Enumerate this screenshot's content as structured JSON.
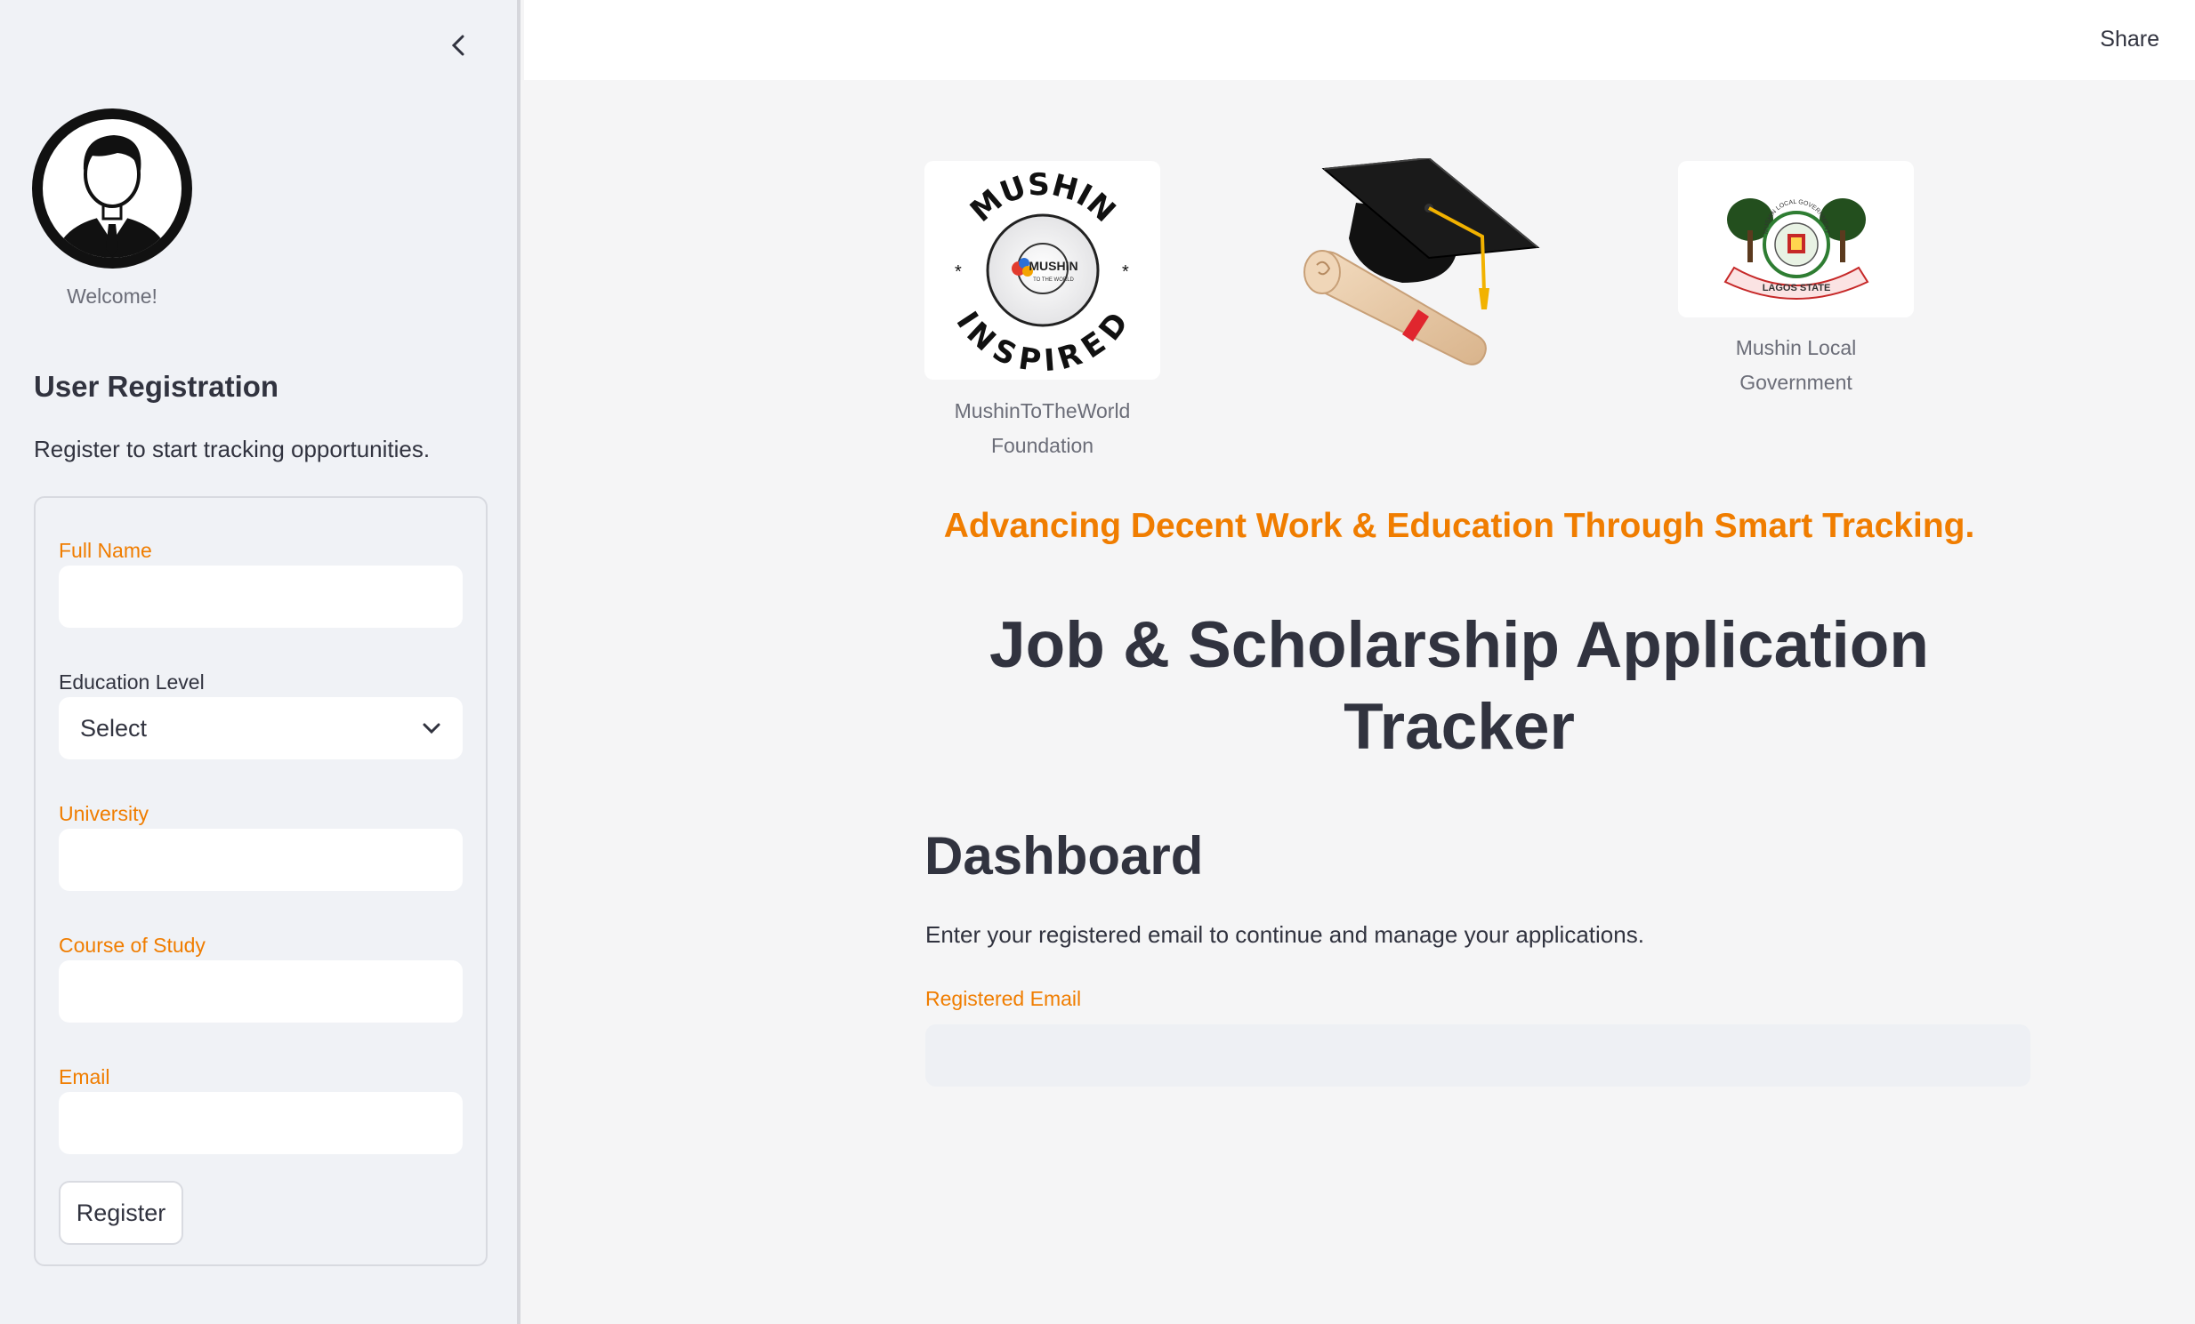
{
  "sidebar": {
    "welcome": "Welcome!",
    "title": "User Registration",
    "subtitle": "Register to start tracking opportunities.",
    "form": {
      "full_name_label": "Full Name",
      "full_name_value": "",
      "education_label": "Education Level",
      "education_selected": "Select",
      "university_label": "University",
      "university_value": "",
      "course_label": "Course of Study",
      "course_value": "",
      "email_label": "Email",
      "email_value": "",
      "register_label": "Register"
    }
  },
  "header": {
    "share_label": "Share"
  },
  "main": {
    "logos": [
      {
        "caption": "MushinToTheWorld Foundation",
        "text_top": "MUSHIN",
        "text_bottom": "INSPIRED",
        "inner_text": "MUSHIN",
        "inner_sub": "TO THE WORLD"
      },
      {
        "caption": ""
      },
      {
        "caption": "Mushin Local Government",
        "ring_text": "MUSHIN LOCAL GOVERNMENT",
        "banner_text": "LAGOS STATE"
      }
    ],
    "tagline": "Advancing Decent Work & Education Through Smart Tracking.",
    "title": "Job & Scholarship Application Tracker",
    "dashboard": {
      "heading": "Dashboard",
      "description": "Enter your registered email to continue and manage your applications.",
      "email_label": "Registered Email",
      "email_value": ""
    }
  },
  "colors": {
    "accent": "#f07d00",
    "text": "#31333f",
    "sidebar_bg": "#f0f2f6",
    "main_bg": "#f5f5f6"
  }
}
